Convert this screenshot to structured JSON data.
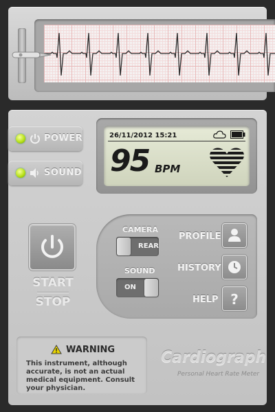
{
  "side_buttons": [
    {
      "label": "POWER",
      "icon": "power-icon"
    },
    {
      "label": "SOUND",
      "icon": "speaker-icon"
    }
  ],
  "lcd": {
    "datetime": "26/11/2012 15:21",
    "bpm": "95",
    "unit": "BPM",
    "status_icons": [
      "cloud-icon",
      "battery-icon",
      "heart-icon"
    ]
  },
  "start_stop": {
    "start": "START",
    "stop": "STOP"
  },
  "controls": {
    "camera": {
      "label": "CAMERA",
      "value": "REAR"
    },
    "sound": {
      "label": "SOUND",
      "value": "ON"
    },
    "menu": [
      {
        "label": "PROFILE",
        "icon": "user-icon"
      },
      {
        "label": "HISTORY",
        "icon": "clock-icon"
      },
      {
        "label": "HELP",
        "icon": "question-icon"
      }
    ]
  },
  "warning": {
    "title": "WARNING",
    "text": "This instrument, although accurate, is not an actual medical equipment. Consult your physician."
  },
  "brand": {
    "title": "Cardiograph",
    "subtitle": "Personal Heart Rate Meter"
  },
  "colors": {
    "led": "#b8e21a",
    "panel": "#c8c8c8",
    "lcd": "#dfe3cc",
    "trace": "#2a2a2a",
    "grid": "#e9b9b9"
  }
}
